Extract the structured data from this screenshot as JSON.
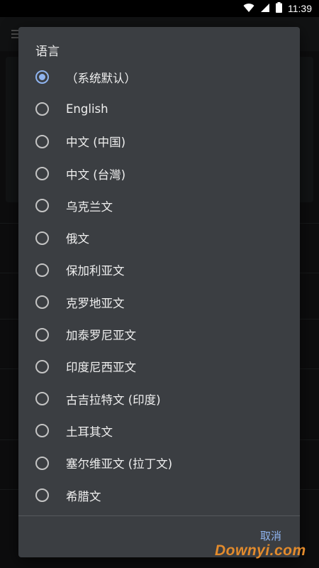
{
  "status_bar": {
    "time": "11:39",
    "icons": [
      "wifi-icon",
      "signal-icon",
      "battery-icon"
    ]
  },
  "dialog": {
    "title": "语言",
    "options": [
      {
        "label": "（系统默认）",
        "selected": true
      },
      {
        "label": "English",
        "selected": false
      },
      {
        "label": "中文 (中国)",
        "selected": false
      },
      {
        "label": "中文 (台灣)",
        "selected": false
      },
      {
        "label": "乌克兰文",
        "selected": false
      },
      {
        "label": "俄文",
        "selected": false
      },
      {
        "label": "保加利亚文",
        "selected": false
      },
      {
        "label": "克罗地亚文",
        "selected": false
      },
      {
        "label": "加泰罗尼亚文",
        "selected": false
      },
      {
        "label": "印度尼西亚文",
        "selected": false
      },
      {
        "label": "古吉拉特文 (印度)",
        "selected": false
      },
      {
        "label": "土耳其文",
        "selected": false
      },
      {
        "label": "塞尔维亚文 (拉丁文)",
        "selected": false
      },
      {
        "label": "希腊文",
        "selected": false
      }
    ],
    "cancel_label": "取消"
  },
  "watermark": "Downyi.com",
  "colors": {
    "accent": "#8fb4f0",
    "dialog_bg": "#3b3e42",
    "watermark": "#e38b2c"
  }
}
